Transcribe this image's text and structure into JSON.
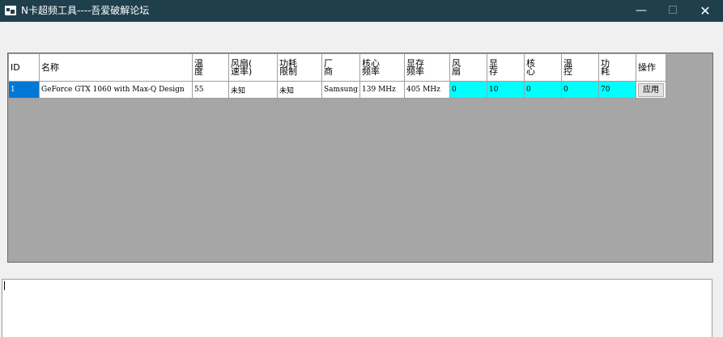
{
  "window": {
    "title": "N卡超频工具----吾爱破解论坛",
    "minimize_glyph": "—",
    "close_glyph": "✕"
  },
  "table": {
    "headers": [
      "ID",
      "名称",
      "温\n度",
      "风扇(\n速率)",
      "功耗\n限制",
      "厂\n商",
      "核心\n频率",
      "显存\n频率",
      "风\n扇",
      "显\n存",
      "核\n心",
      "温\n控",
      "功\n耗",
      "操作"
    ],
    "rows": [
      {
        "id": "1",
        "name": "GeForce GTX 1060 with Max-Q Design",
        "temp": "55",
        "fan_speed": "未知",
        "power_limit": "未知",
        "vendor": "Samsung",
        "core_freq": "139 MHz",
        "mem_freq": "405 MHz",
        "fan": "0",
        "mem_oc": "10",
        "core_oc": "0",
        "temp_limit": "0",
        "power_oc": "70",
        "action": "应用"
      }
    ]
  },
  "log": {
    "text": ""
  },
  "colors": {
    "titlebar": "#1f3f4d",
    "selected": "#0078d7",
    "editable_cells": "#00ffff",
    "grid_background": "#a6a6a6"
  }
}
